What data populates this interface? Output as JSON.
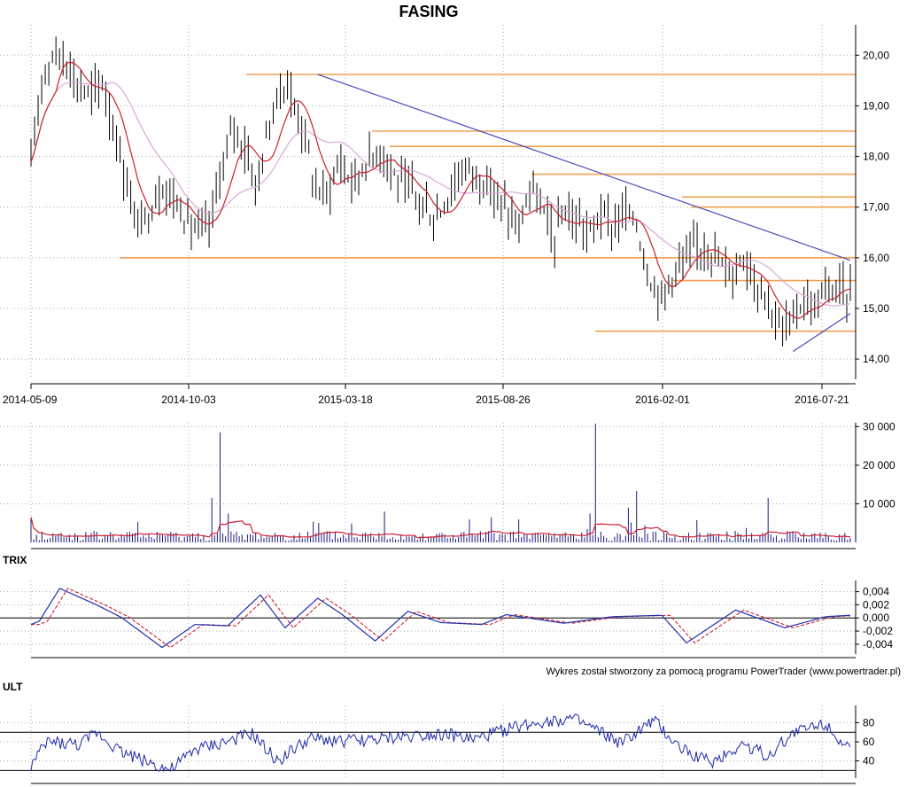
{
  "chart_data": [
    {
      "type": "ohlc",
      "title": "FASING",
      "x_tick_labels": [
        "2014-05-09",
        "2014-10-03",
        "2015-03-18",
        "2015-08-26",
        "2016-02-01",
        "2016-07-21"
      ],
      "y_tick_labels": [
        "14,00",
        "15,00",
        "16,00",
        "17,00",
        "18,00",
        "19,00",
        "20,00"
      ],
      "ylim": [
        13.6,
        20.6
      ],
      "grid": true,
      "price_path": [
        [
          0,
          17.75
        ],
        [
          3,
          19.6
        ],
        [
          7,
          20.1
        ],
        [
          10,
          19.9
        ],
        [
          13,
          19.4
        ],
        [
          17,
          19.2
        ],
        [
          20,
          19.5
        ],
        [
          23,
          18.6
        ],
        [
          27,
          17.4
        ],
        [
          30,
          16.6
        ],
        [
          33,
          16.9
        ],
        [
          37,
          17.4
        ],
        [
          40,
          17.2
        ],
        [
          43,
          16.8
        ],
        [
          47,
          16.5
        ],
        [
          50,
          16.6
        ],
        [
          53,
          17.6
        ],
        [
          57,
          18.6
        ],
        [
          60,
          18.2
        ],
        [
          63,
          17.4
        ],
        [
          67,
          18.6
        ],
        [
          70,
          19.4
        ],
        [
          73,
          19.2
        ],
        [
          77,
          18.4
        ],
        [
          80,
          17.3
        ],
        [
          83,
          17.3
        ],
        [
          87,
          17.9
        ],
        [
          90,
          17.5
        ],
        [
          93,
          17.8
        ],
        [
          97,
          18.1
        ],
        [
          100,
          18.0
        ],
        [
          103,
          17.5
        ],
        [
          107,
          17.3
        ],
        [
          110,
          17.1
        ],
        [
          113,
          16.7
        ],
        [
          117,
          17.2
        ],
        [
          120,
          17.6
        ],
        [
          123,
          17.8
        ],
        [
          127,
          17.5
        ],
        [
          130,
          17.3
        ],
        [
          133,
          17.0
        ],
        [
          137,
          16.5
        ],
        [
          140,
          17.4
        ],
        [
          143,
          17.0
        ],
        [
          147,
          16.4
        ],
        [
          150,
          16.9
        ],
        [
          153,
          16.7
        ],
        [
          157,
          16.5
        ],
        [
          160,
          16.9
        ],
        [
          163,
          16.6
        ],
        [
          167,
          16.9
        ],
        [
          170,
          16.7
        ],
        [
          173,
          15.7
        ],
        [
          177,
          15.2
        ],
        [
          180,
          15.7
        ],
        [
          183,
          15.9
        ],
        [
          187,
          16.2
        ],
        [
          190,
          16.3
        ],
        [
          193,
          15.9
        ],
        [
          197,
          15.7
        ],
        [
          200,
          16.1
        ],
        [
          203,
          15.6
        ],
        [
          207,
          15.2
        ],
        [
          210,
          14.6
        ],
        [
          213,
          14.7
        ],
        [
          217,
          15.2
        ],
        [
          220,
          15.0
        ],
        [
          223,
          15.3
        ],
        [
          227,
          15.4
        ],
        [
          230,
          15.3
        ]
      ],
      "series": [
        {
          "values_source": "price_path",
          "color": "#000000"
        },
        {
          "role": "short moving average",
          "color": "#cc1f2a"
        },
        {
          "role": "long moving average",
          "color": "#d9a8d8"
        }
      ],
      "levels": [
        {
          "value": 19.62,
          "color": "#f3a052"
        },
        {
          "value": 18.5,
          "color": "#f3a052"
        },
        {
          "value": 18.2,
          "color": "#f3a052"
        },
        {
          "value": 17.65,
          "color": "#f3a052"
        },
        {
          "value": 17.2,
          "color": "#f3a052"
        },
        {
          "value": 17.0,
          "color": "#f3a052"
        },
        {
          "value": 16.0,
          "color": "#f3a052"
        },
        {
          "value": 15.55,
          "color": "#f3a052"
        },
        {
          "value": 14.55,
          "color": "#f3a052"
        }
      ],
      "trendlines": [
        {
          "points": [
            [
              0.35,
              19.62
            ],
            [
              1.0,
              15.95
            ]
          ],
          "color": "#4a4cc0"
        },
        {
          "points": [
            [
              0.93,
              14.15
            ],
            [
              1.0,
              14.9
            ]
          ],
          "color": "#4a4cc0"
        }
      ]
    },
    {
      "type": "bar",
      "y_tick_labels": [
        "10 000",
        "20 000",
        "30 000"
      ],
      "ylim": [
        0,
        31000
      ],
      "grid": true,
      "spikes": [
        [
          0.23,
          28500
        ],
        [
          0.22,
          11500
        ],
        [
          0.24,
          7500
        ],
        [
          0.69,
          30800
        ],
        [
          0.74,
          13300
        ],
        [
          0.9,
          11500
        ],
        [
          0.73,
          9000
        ],
        [
          0.43,
          8000
        ]
      ],
      "baseline_volume": 2000,
      "colors": {
        "bars": "#1a1a80",
        "average": "#d02030"
      }
    },
    {
      "type": "line",
      "title": "TRIX",
      "y_tick_labels": [
        "0,004",
        "0,002",
        "0,000",
        "-0,002",
        "-0,004"
      ],
      "ylim": [
        -0.0055,
        0.0057
      ],
      "grid": true,
      "trix": [
        [
          0,
          -0.001
        ],
        [
          0.01,
          -0.0005
        ],
        [
          0.035,
          0.0045
        ],
        [
          0.08,
          0.002
        ],
        [
          0.11,
          0.0001
        ],
        [
          0.16,
          -0.0045
        ],
        [
          0.2,
          -0.001
        ],
        [
          0.24,
          -0.0012
        ],
        [
          0.28,
          0.0035
        ],
        [
          0.31,
          -0.0015
        ],
        [
          0.35,
          0.003
        ],
        [
          0.38,
          0.0005
        ],
        [
          0.42,
          -0.0035
        ],
        [
          0.46,
          0.001
        ],
        [
          0.5,
          -0.0007
        ],
        [
          0.55,
          -0.001
        ],
        [
          0.58,
          0.0005
        ],
        [
          0.65,
          -0.0008
        ],
        [
          0.71,
          0.0002
        ],
        [
          0.77,
          0.0004
        ],
        [
          0.8,
          -0.0038
        ],
        [
          0.86,
          0.0012
        ],
        [
          0.92,
          -0.0015
        ],
        [
          0.97,
          0.0002
        ],
        [
          1.0,
          0.0004
        ]
      ],
      "colors": {
        "trix": "#2030b0",
        "signal": "#d02030"
      }
    },
    {
      "type": "line",
      "title": "ULT",
      "y_tick_labels": [
        "40",
        "60",
        "80"
      ],
      "ylim": [
        22,
        98
      ],
      "reference_lines": [
        70,
        30
      ],
      "grid": true,
      "ult": [
        [
          0,
          35
        ],
        [
          0.02,
          60
        ],
        [
          0.06,
          57
        ],
        [
          0.08,
          70
        ],
        [
          0.11,
          50
        ],
        [
          0.14,
          40
        ],
        [
          0.17,
          30
        ],
        [
          0.2,
          52
        ],
        [
          0.23,
          58
        ],
        [
          0.27,
          68
        ],
        [
          0.3,
          40
        ],
        [
          0.34,
          63
        ],
        [
          0.38,
          61
        ],
        [
          0.42,
          62
        ],
        [
          0.46,
          66
        ],
        [
          0.5,
          69
        ],
        [
          0.54,
          62
        ],
        [
          0.58,
          73
        ],
        [
          0.62,
          81
        ],
        [
          0.66,
          84
        ],
        [
          0.69,
          72
        ],
        [
          0.72,
          58
        ],
        [
          0.76,
          82
        ],
        [
          0.79,
          55
        ],
        [
          0.83,
          38
        ],
        [
          0.87,
          58
        ],
        [
          0.9,
          45
        ],
        [
          0.93,
          70
        ],
        [
          0.97,
          80
        ],
        [
          1.0,
          50
        ]
      ],
      "color": "#1c2aa8"
    }
  ],
  "credit": "Wykres został stworzony za pomocą programu PowerTrader (www.powertrader.pl)"
}
